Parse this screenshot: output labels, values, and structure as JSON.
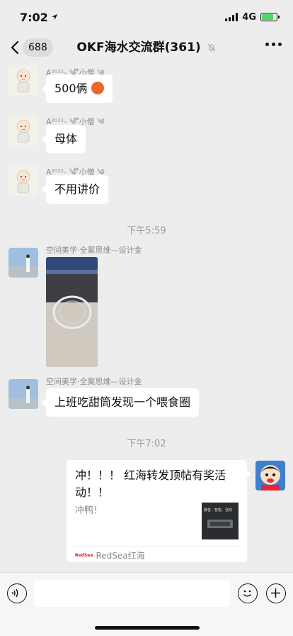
{
  "status_bar": {
    "time": "7:02",
    "network": "4G"
  },
  "nav": {
    "unread_count": "688",
    "title": "OKF海水交流群(361)"
  },
  "messages": [
    {
      "sender": "A²⁰²¹- ༄ ໊小僧 ༄",
      "text": "500俩"
    },
    {
      "sender": "A²⁰²¹- ༄ ໊小僧 ༄",
      "text": "母体"
    },
    {
      "sender": "A²⁰²¹- ༄ ໊小僧 ༄",
      "text": "不用讲价"
    },
    {
      "timestamp": "下午5:59"
    },
    {
      "sender": "空间美学·全案思维—设计金"
    },
    {
      "sender": "空间美学·全案思维—设计金",
      "text": "上班吃甜筒发现一个喂食圈"
    },
    {
      "timestamp": "下午7:02"
    }
  ],
  "link_card": {
    "title": "冲！！！ 红海转发顶帖有奖活动！！",
    "description": "冲鸭！",
    "thumb_text": "静音、智能、强劲",
    "source": "RedSea红海",
    "source_logo": "RedSea"
  },
  "colors": {
    "background": "#ededed",
    "bubble": "#ffffff",
    "battery": "#4cd964"
  }
}
